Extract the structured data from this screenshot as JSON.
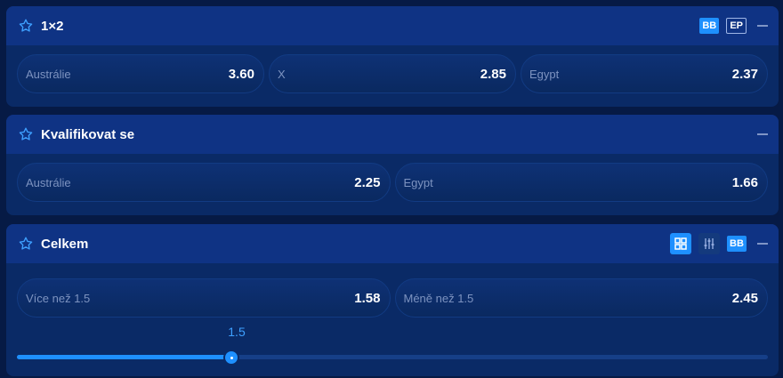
{
  "markets": [
    {
      "title": "1×2",
      "badges": {
        "bb": "BB",
        "ep": "EP"
      },
      "odds": [
        {
          "label": "Austrálie",
          "value": "3.60"
        },
        {
          "label": "X",
          "value": "2.85"
        },
        {
          "label": "Egypt",
          "value": "2.37"
        }
      ]
    },
    {
      "title": "Kvalifikovat se",
      "odds": [
        {
          "label": "Austrálie",
          "value": "2.25"
        },
        {
          "label": "Egypt",
          "value": "1.66"
        }
      ]
    },
    {
      "title": "Celkem",
      "badges": {
        "bb": "BB"
      },
      "odds": [
        {
          "label": "Více než 1.5",
          "value": "1.58"
        },
        {
          "label": "Méně než 1.5",
          "value": "2.45"
        }
      ],
      "slider": {
        "value": "1.5"
      }
    }
  ],
  "colors": {
    "accent": "#1e90ff",
    "panel": "#0a2a66",
    "header": "#0f3384",
    "label": "#7d93c0"
  },
  "icons": [
    "star-icon",
    "minus-icon",
    "grid-icon",
    "sliders-icon"
  ]
}
